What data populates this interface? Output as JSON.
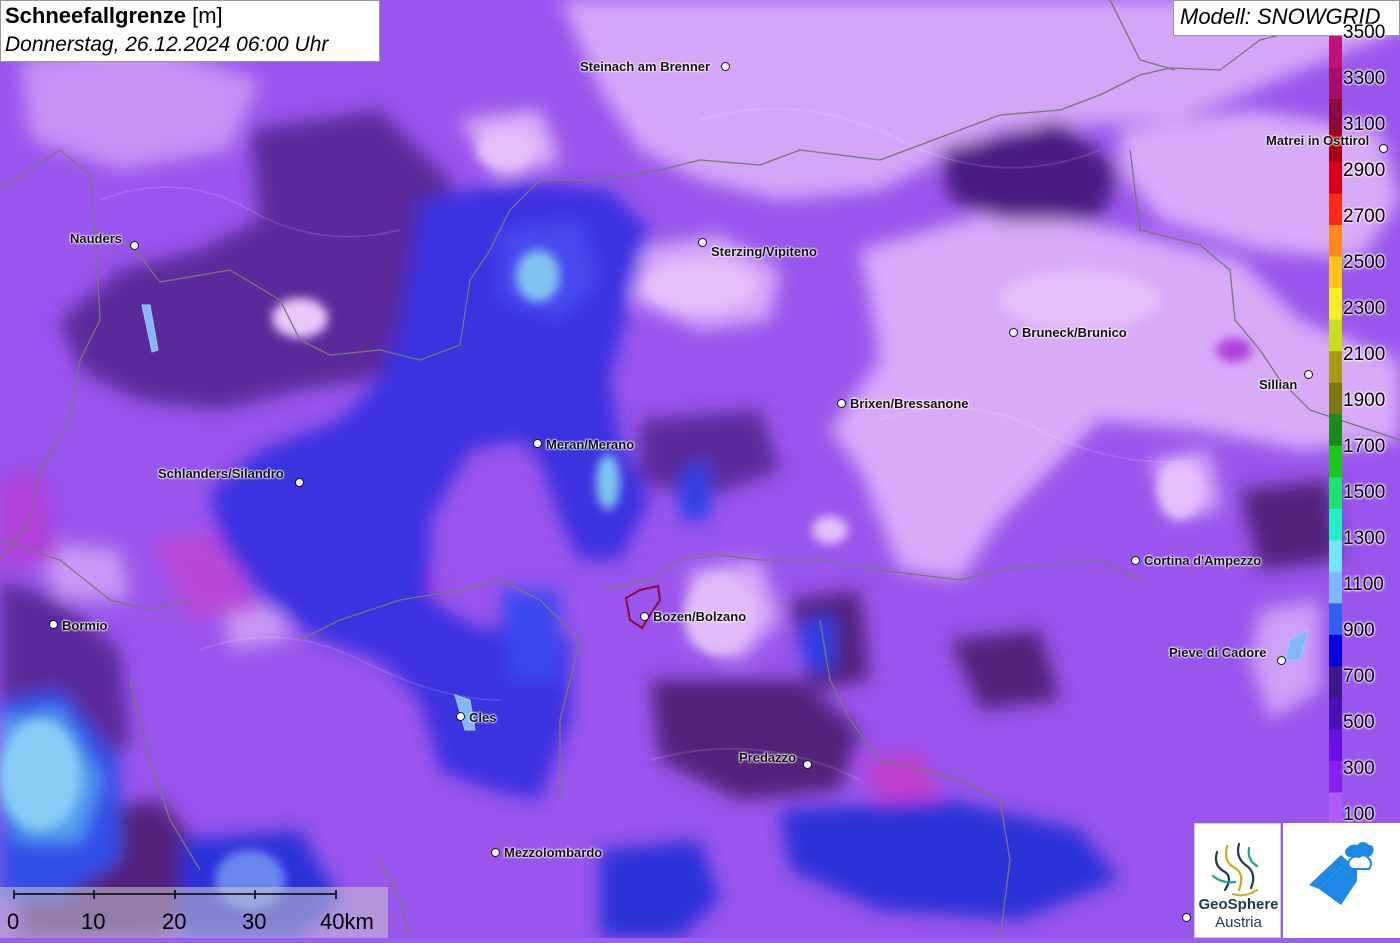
{
  "title": {
    "main": "Schneefallgrenze",
    "unit": "[m]",
    "datetime": "Donnerstag, 26.12.2024 06:00 Uhr"
  },
  "model": "Modell: SNOWGRID",
  "legend": {
    "labels": [
      "3500",
      "3300",
      "3100",
      "2900",
      "2700",
      "2500",
      "2300",
      "2100",
      "1900",
      "1700",
      "1500",
      "1300",
      "1100",
      "900",
      "700",
      "500",
      "300",
      "100"
    ],
    "colors": [
      "#c2127a",
      "#a80e67",
      "#8a0a3c",
      "#a80018",
      "#d8001b",
      "#ff2a14",
      "#ff8c1a",
      "#ffc21a",
      "#f5f020",
      "#c8dc20",
      "#a89a10",
      "#7a7a10",
      "#1a8a1a",
      "#1ac81a",
      "#20e070",
      "#20f0c8",
      "#70e8f8",
      "#80b8f8",
      "#3060f0",
      "#0000e0",
      "#3a1a8a",
      "#4a10b8",
      "#6a10e0",
      "#8a20f0",
      "#b05cf5"
    ]
  },
  "cities": [
    {
      "name": "Steinach am Brenner"
    },
    {
      "name": "Matrei in Osttirol"
    },
    {
      "name": "Nauders"
    },
    {
      "name": "Sterzing/Vipiteno"
    },
    {
      "name": "Bruneck/Brunico"
    },
    {
      "name": "Sillian"
    },
    {
      "name": "Brixen/Bressanone"
    },
    {
      "name": "Meran/Merano"
    },
    {
      "name": "Schlanders/Silandro"
    },
    {
      "name": "Cortina d'Ampezzo"
    },
    {
      "name": "Bozen/Bolzano"
    },
    {
      "name": "Bormio"
    },
    {
      "name": "Pieve di Cadore"
    },
    {
      "name": "Cles"
    },
    {
      "name": "Predazzo"
    },
    {
      "name": "Mezzolombardo"
    }
  ],
  "scale": {
    "labels": [
      "0",
      "10",
      "20",
      "30",
      "40km"
    ]
  },
  "logos": {
    "geosphere_line1": "GeoSphere",
    "geosphere_line2": "Austria"
  },
  "colors": {
    "lilac_high": "#d8aaf8",
    "violet": "#a24cf0",
    "dark_purple": "#52207a",
    "blue": "#3a30e8",
    "light_blue": "#7ac4f0",
    "magenta": "#c030d0"
  }
}
